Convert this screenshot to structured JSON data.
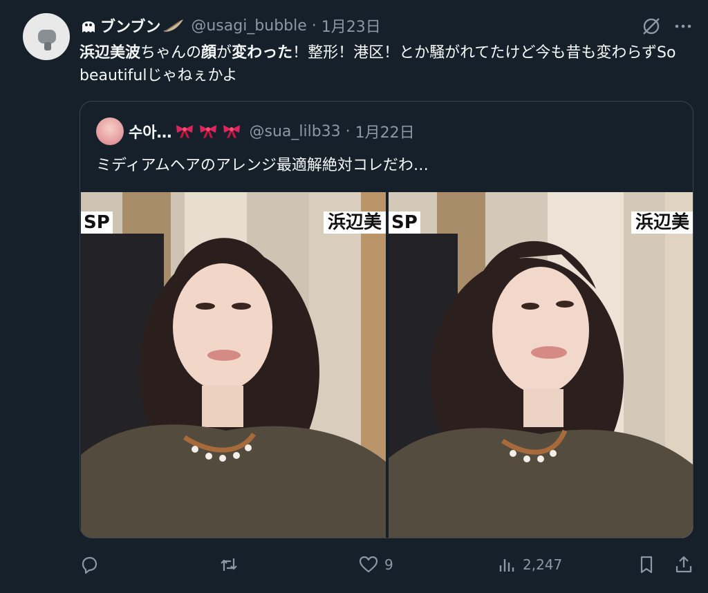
{
  "tweet": {
    "display_name": "ブンブン",
    "handle": "@usagi_bubble",
    "date": "1月23日",
    "text_parts": [
      {
        "t": "浜辺美波",
        "b": true
      },
      {
        "t": "ちゃんの",
        "b": false
      },
      {
        "t": "顔",
        "b": true
      },
      {
        "t": "が",
        "b": false
      },
      {
        "t": "変わった",
        "b": true
      },
      {
        "t": "！整形！港区！とか騒がれてたけど今も昔も変わらずSo beautifulじゃねぇかよ",
        "b": false
      }
    ]
  },
  "quote": {
    "display_name": "수아…",
    "handle": "@sua_lilb33",
    "date": "1月22日",
    "text": "ミディアムヘアのアレンジ最適解絶対コレだわ…",
    "images": [
      {
        "sp_label": "SP",
        "name_label": "浜辺美"
      },
      {
        "sp_label": "SP",
        "name_label": "浜辺美"
      }
    ]
  },
  "actions": {
    "reply": "",
    "retweet": "",
    "like_count": "9",
    "views": "2,247"
  },
  "icons": {
    "avatar": "avatar-icon",
    "ghost": "ghost-emoji-icon",
    "feather": "feather-emoji-icon",
    "grok": "grok-icon",
    "more": "more-icon",
    "bow": "ribbon-emoji-icon",
    "reply": "reply-icon",
    "retweet": "retweet-icon",
    "like": "heart-icon",
    "views": "views-icon",
    "bookmark": "bookmark-icon",
    "share": "share-icon"
  },
  "colors": {
    "background": "#15202b",
    "secondary_text": "#8b98a5",
    "border": "#38444d",
    "bow": "#e0245e"
  }
}
